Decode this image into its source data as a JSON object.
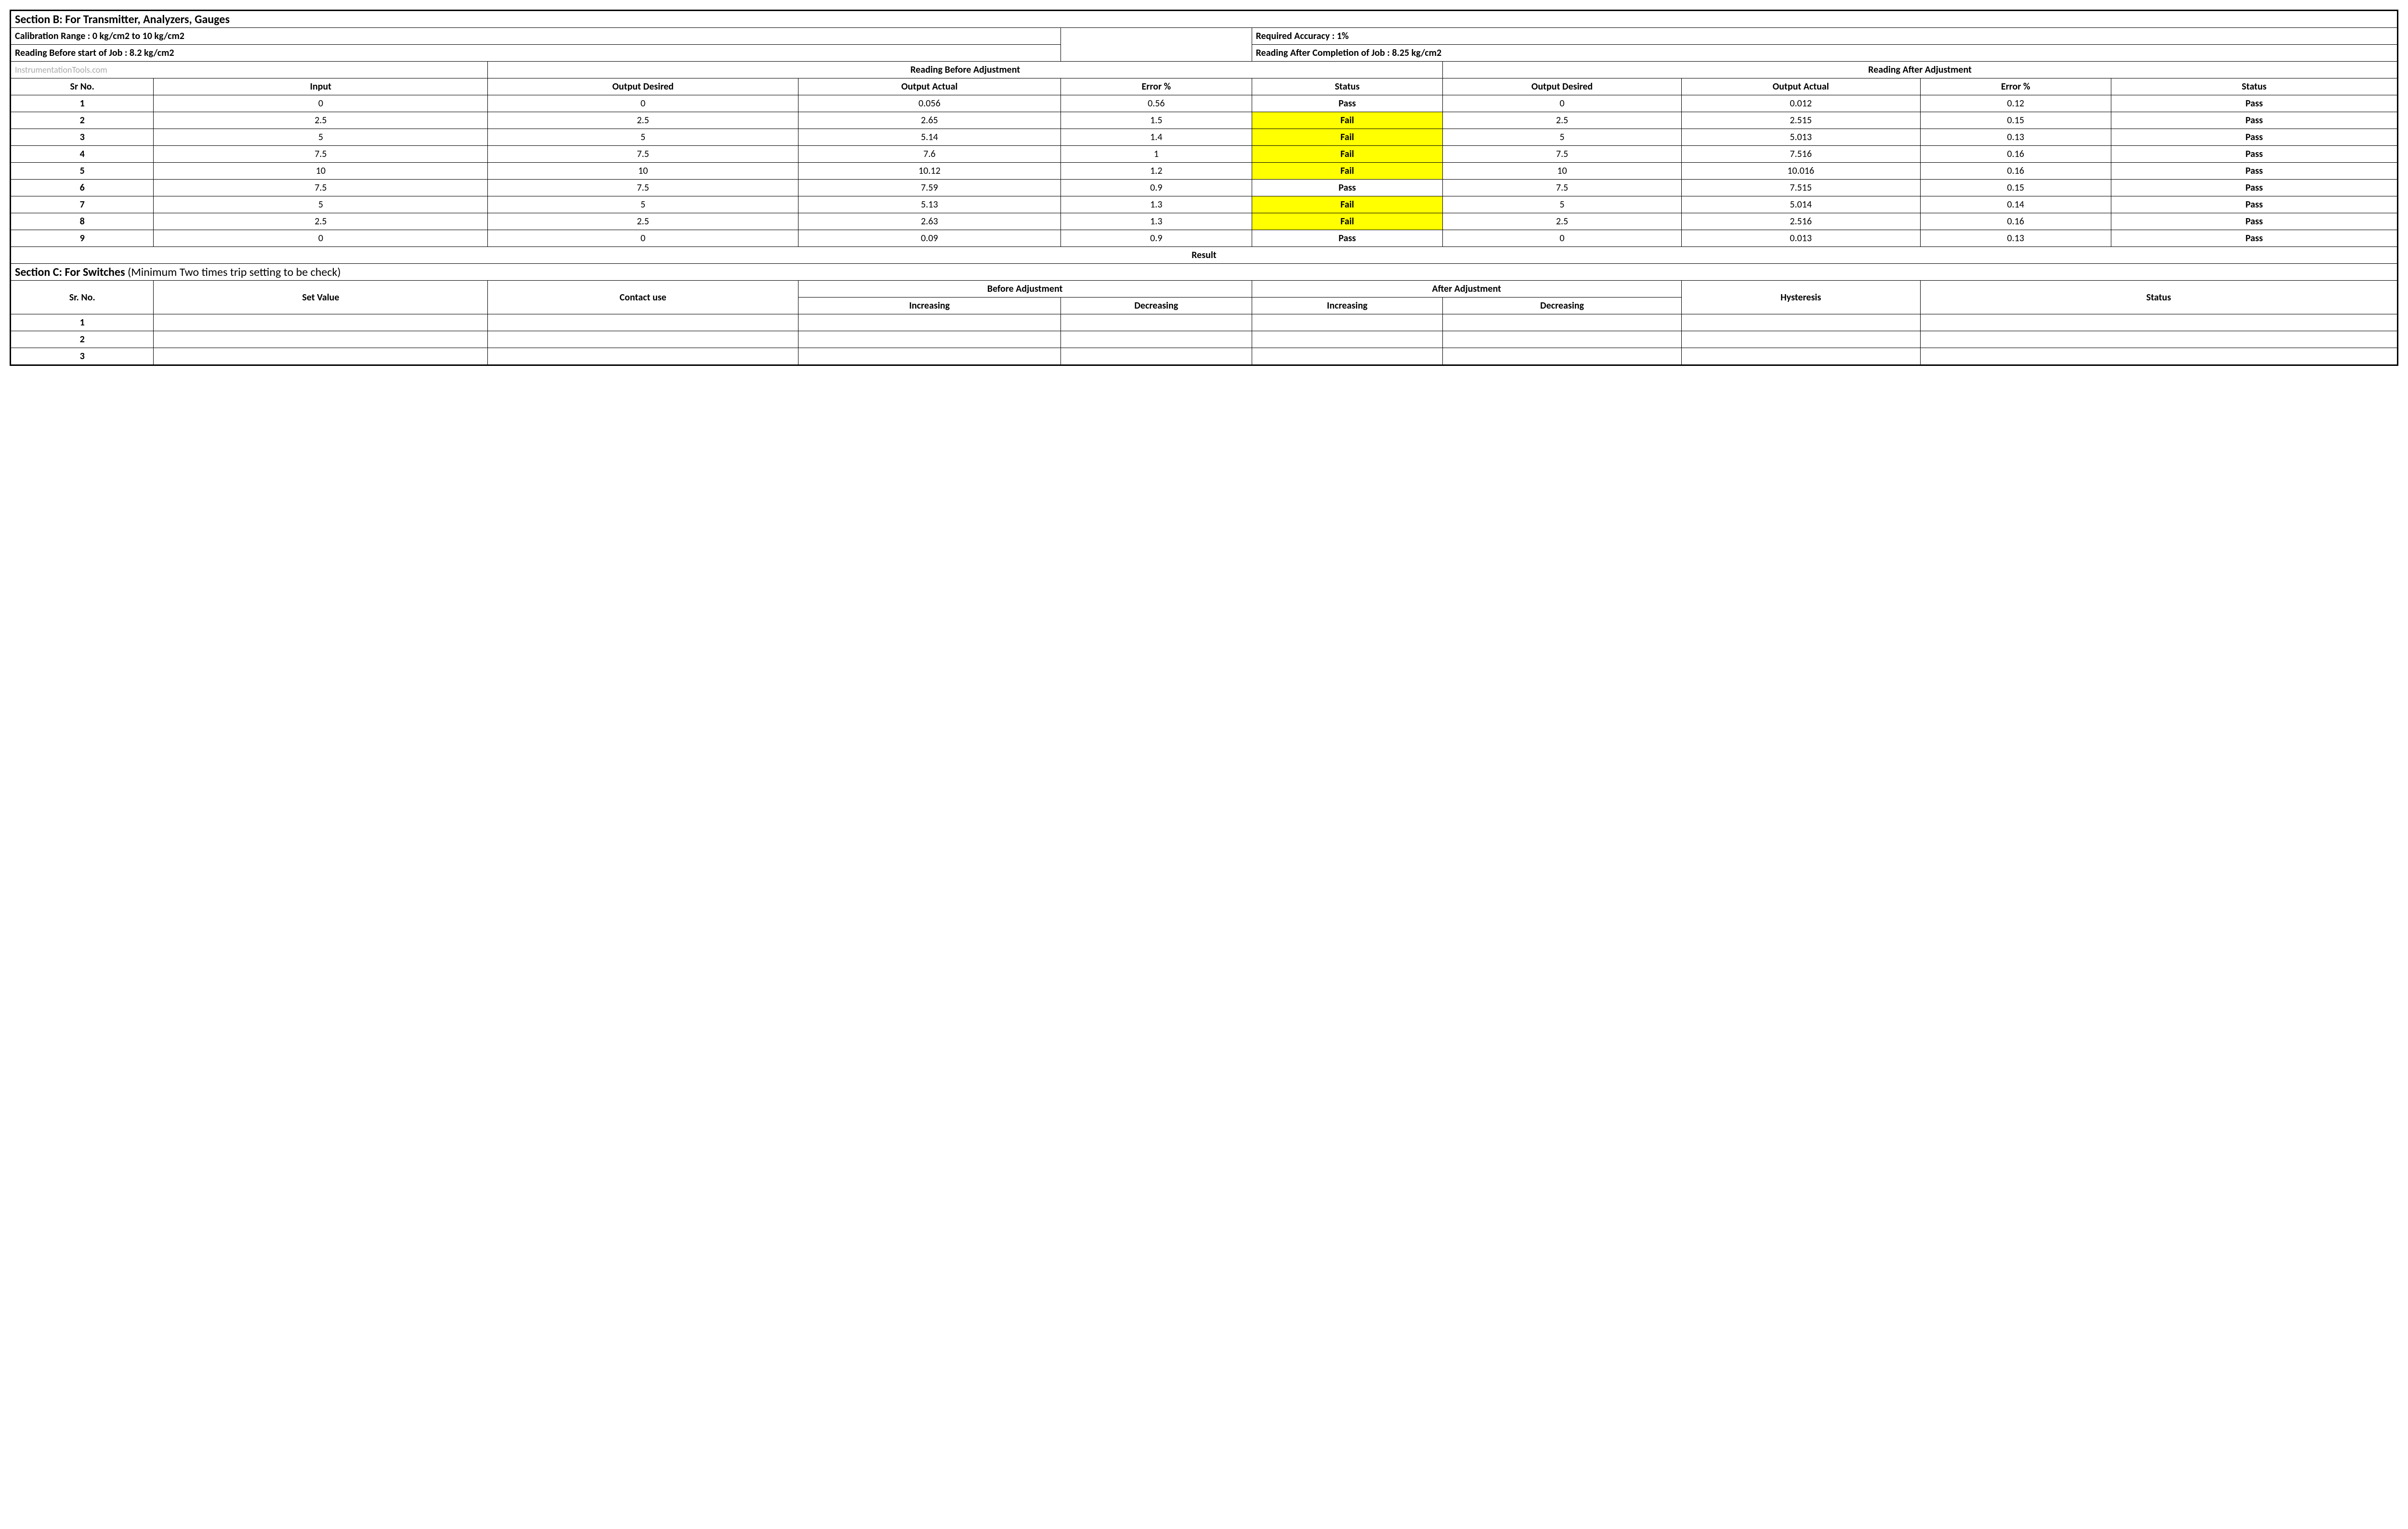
{
  "sectionB": {
    "title": "Section B:  For Transmitter, Analyzers, Gauges",
    "calibration_range": "Calibration Range : 0 kg/cm2 to 10 kg/cm2",
    "required_accuracy": "Required Accuracy : 1%",
    "reading_before": "Reading Before start of Job : 8.2 kg/cm2",
    "reading_after": "Reading After Completion of Job : 8.25 kg/cm2",
    "watermark": "InstrumentationTools.com",
    "group_before": "Reading Before Adjustment",
    "group_after": "Reading After Adjustment",
    "headers": {
      "sr": "Sr No.",
      "input": "Input",
      "out_desired": "Output Desired",
      "out_actual": "Output Actual",
      "error": "Error %",
      "status": "Status"
    },
    "rows": [
      {
        "sr": "1",
        "input": "0",
        "bd": "0",
        "ba": "0.056",
        "be": "0.56",
        "bs": "Pass",
        "ad": "0",
        "aa": "0.012",
        "ae": "0.12",
        "as": "Pass"
      },
      {
        "sr": "2",
        "input": "2.5",
        "bd": "2.5",
        "ba": "2.65",
        "be": "1.5",
        "bs": "Fail",
        "ad": "2.5",
        "aa": "2.515",
        "ae": "0.15",
        "as": "Pass"
      },
      {
        "sr": "3",
        "input": "5",
        "bd": "5",
        "ba": "5.14",
        "be": "1.4",
        "bs": "Fail",
        "ad": "5",
        "aa": "5.013",
        "ae": "0.13",
        "as": "Pass"
      },
      {
        "sr": "4",
        "input": "7.5",
        "bd": "7.5",
        "ba": "7.6",
        "be": "1",
        "bs": "Fail",
        "ad": "7.5",
        "aa": "7.516",
        "ae": "0.16",
        "as": "Pass"
      },
      {
        "sr": "5",
        "input": "10",
        "bd": "10",
        "ba": "10.12",
        "be": "1.2",
        "bs": "Fail",
        "ad": "10",
        "aa": "10.016",
        "ae": "0.16",
        "as": "Pass"
      },
      {
        "sr": "6",
        "input": "7.5",
        "bd": "7.5",
        "ba": "7.59",
        "be": "0.9",
        "bs": "Pass",
        "ad": "7.5",
        "aa": "7.515",
        "ae": "0.15",
        "as": "Pass"
      },
      {
        "sr": "7",
        "input": "5",
        "bd": "5",
        "ba": "5.13",
        "be": "1.3",
        "bs": "Fail",
        "ad": "5",
        "aa": "5.014",
        "ae": "0.14",
        "as": "Pass"
      },
      {
        "sr": "8",
        "input": "2.5",
        "bd": "2.5",
        "ba": "2.63",
        "be": "1.3",
        "bs": "Fail",
        "ad": "2.5",
        "aa": "2.516",
        "ae": "0.16",
        "as": "Pass"
      },
      {
        "sr": "9",
        "input": "0",
        "bd": "0",
        "ba": "0.09",
        "be": "0.9",
        "bs": "Pass",
        "ad": "0",
        "aa": "0.013",
        "ae": "0.13",
        "as": "Pass"
      }
    ],
    "result_label": "Result"
  },
  "sectionC": {
    "title_bold": "Section C:  For Switches",
    "title_rest": "   (Minimum Two times trip setting to be check)",
    "headers": {
      "sr": "Sr. No.",
      "set_value": "Set Value",
      "contact_use": "Contact use",
      "before": "Before Adjustment",
      "after": "After Adjustment",
      "increasing": "Increasing",
      "decreasing": "Decreasing",
      "hysteresis": "Hysteresis",
      "status": "Status"
    },
    "rows": [
      {
        "sr": "1"
      },
      {
        "sr": "2"
      },
      {
        "sr": "3"
      }
    ]
  },
  "chart_data": {
    "type": "table",
    "title": "Calibration Readings Before/After Adjustment",
    "columns": [
      "Sr No.",
      "Input",
      "Output Desired (Before)",
      "Output Actual (Before)",
      "Error % (Before)",
      "Status (Before)",
      "Output Desired (After)",
      "Output Actual (After)",
      "Error % (After)",
      "Status (After)"
    ],
    "rows": [
      [
        1,
        0,
        0,
        0.056,
        0.56,
        "Pass",
        0,
        0.012,
        0.12,
        "Pass"
      ],
      [
        2,
        2.5,
        2.5,
        2.65,
        1.5,
        "Fail",
        2.5,
        2.515,
        0.15,
        "Pass"
      ],
      [
        3,
        5,
        5,
        5.14,
        1.4,
        "Fail",
        5,
        5.013,
        0.13,
        "Pass"
      ],
      [
        4,
        7.5,
        7.5,
        7.6,
        1,
        "Fail",
        7.5,
        7.516,
        0.16,
        "Pass"
      ],
      [
        5,
        10,
        10,
        10.12,
        1.2,
        "Fail",
        10,
        10.016,
        0.16,
        "Pass"
      ],
      [
        6,
        7.5,
        7.5,
        7.59,
        0.9,
        "Pass",
        7.5,
        7.515,
        0.15,
        "Pass"
      ],
      [
        7,
        5,
        5,
        5.13,
        1.3,
        "Fail",
        5,
        5.014,
        0.14,
        "Pass"
      ],
      [
        8,
        2.5,
        2.5,
        2.63,
        1.3,
        "Fail",
        2.5,
        2.516,
        0.16,
        "Pass"
      ],
      [
        9,
        0,
        0,
        0.09,
        0.9,
        "Pass",
        0,
        0.013,
        0.13,
        "Pass"
      ]
    ]
  }
}
